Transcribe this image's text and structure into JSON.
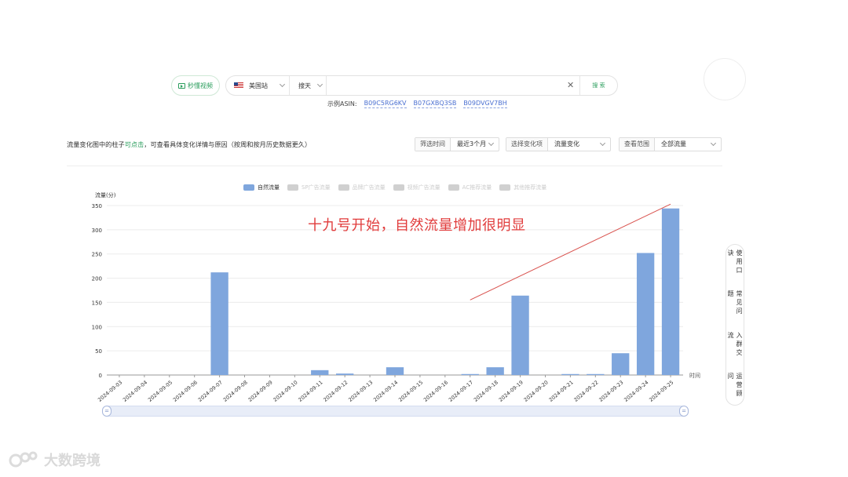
{
  "search": {
    "video_button": "秒懂视频",
    "site": "美国站",
    "mode": "搜天",
    "input_value": "",
    "clear_icon": "close-icon",
    "search_button": "搜 索",
    "examples_label": "示例ASIN:",
    "examples": [
      "B09C5RG6KV",
      "B07GXBQ3SB",
      "B09DVGV7BH"
    ]
  },
  "filters": {
    "hint_before": "流量变化图中的柱子",
    "hint_clickable": "可点击",
    "hint_after": "，可查看具体变化详情与原因（按周和按月历史数据更久）",
    "time_label": "筛选时间",
    "time_value": "最近3个月",
    "change_label": "选择变化项",
    "change_value": "流量变化",
    "range_label": "查看范围",
    "range_value": "全部流量"
  },
  "legend": [
    {
      "label": "自然流量",
      "active": true,
      "color": "#7fa6dd"
    },
    {
      "label": "SP广告流量",
      "active": false,
      "color": "#d0d0d0"
    },
    {
      "label": "品牌广告流量",
      "active": false,
      "color": "#d0d0d0"
    },
    {
      "label": "视频广告流量",
      "active": false,
      "color": "#d0d0d0"
    },
    {
      "label": "AC推荐流量",
      "active": false,
      "color": "#d0d0d0"
    },
    {
      "label": "其他推荐流量",
      "active": false,
      "color": "#d0d0d0"
    }
  ],
  "annotation": "十九号开始，自然流量增加很明显",
  "side_panel": [
    "使用口诀",
    "常见问题",
    "入群交流",
    "运营顾问"
  ],
  "watermark": "大数跨境",
  "chart_data": {
    "type": "bar",
    "ylabel": "流量(分)",
    "xlabel": "时间",
    "ylim": [
      0,
      350
    ],
    "yticks": [
      0,
      50,
      100,
      150,
      200,
      250,
      300,
      350
    ],
    "grid": true,
    "categories": [
      "2024-09-03",
      "2024-09-04",
      "2024-09-05",
      "2024-09-06",
      "2024-09-07",
      "2024-09-08",
      "2024-09-09",
      "2024-09-10",
      "2024-09-11",
      "2024-09-12",
      "2024-09-13",
      "2024-09-14",
      "2024-09-15",
      "2024-09-16",
      "2024-09-17",
      "2024-09-18",
      "2024-09-19",
      "2024-09-20",
      "2024-09-21",
      "2024-09-22",
      "2024-09-23",
      "2024-09-24",
      "2024-09-25"
    ],
    "series": [
      {
        "name": "自然流量",
        "color": "#7fa6dd",
        "values": [
          0,
          0,
          0,
          0,
          212,
          0,
          0,
          0,
          10,
          3,
          0,
          16,
          0,
          0,
          2,
          16,
          164,
          0,
          2,
          2,
          45,
          252,
          344
        ]
      }
    ],
    "trend_arrow": {
      "from": "2024-09-17",
      "to": "2024-09-25",
      "color": "#d9534f"
    }
  }
}
